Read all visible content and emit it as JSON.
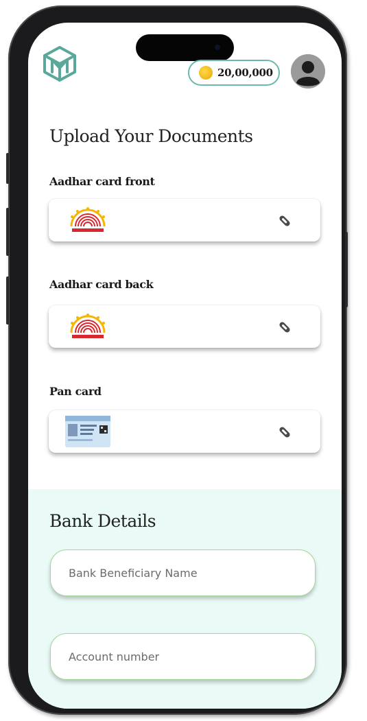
{
  "header": {
    "coin_balance": "20,00,000"
  },
  "documents": {
    "title": "Upload Your Documents",
    "items": [
      {
        "label": "Aadhar card front"
      },
      {
        "label": "Aadhar card back"
      },
      {
        "label": "Pan card"
      }
    ]
  },
  "bank": {
    "title": "Bank Details",
    "beneficiary_placeholder": "Bank Beneficiary Name",
    "account_placeholder": "Account number"
  },
  "colors": {
    "accent_teal": "#6bb8ad",
    "bank_section_bg": "#eafbf7",
    "input_border": "#a6d49a",
    "coin": "#f5c518"
  },
  "icons": {
    "logo": "m-cube-logo",
    "coin": "coin-icon",
    "avatar": "user-avatar-icon",
    "attach": "paperclip-icon"
  }
}
